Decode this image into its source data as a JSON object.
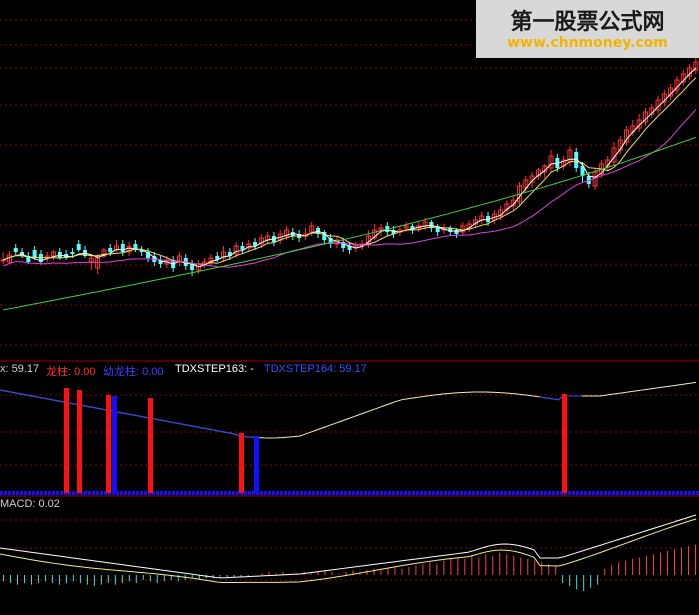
{
  "watermark": {
    "title": "第一股票公式网",
    "url": "www.chnmoney.com"
  },
  "indicator": {
    "items": [
      {
        "text": "x: 59.17",
        "color": "#d0d0d0"
      },
      {
        "text": "龙柱: 0.00",
        "color": "#ff3030"
      },
      {
        "text": "幼龙柱: 0.00",
        "color": "#4040ff"
      },
      {
        "text": "TDXSTEP163: -",
        "color": "#ffffff"
      },
      {
        "text": "TDXSTEP164: 59.17",
        "color": "#3050ff"
      }
    ]
  },
  "macd": {
    "label": "MACD: 0.02"
  },
  "colors": {
    "up": "#ff3030",
    "down": "#54ffff",
    "ma_short": "#ffffff",
    "ma_mid": "#f0e060",
    "ma_long": "#e040e0",
    "ma_longest": "#40d040",
    "grid": "#8a0a0a",
    "bar_red": "#ff1010",
    "bar_blue": "#1010ff",
    "line_blue": "#2040ff",
    "line_yellow": "#f0f0b0"
  },
  "chart_data": {
    "type": "candlestick",
    "candles": [
      [
        261,
        260,
        252,
        264
      ],
      [
        262,
        255,
        251,
        264
      ],
      [
        248,
        252,
        244,
        256
      ],
      [
        252,
        256,
        248,
        258
      ],
      [
        256,
        262,
        252,
        264
      ],
      [
        250,
        258,
        246,
        260
      ],
      [
        254,
        262,
        250,
        264
      ],
      [
        258,
        256,
        252,
        262
      ],
      [
        256,
        252,
        250,
        260
      ],
      [
        252,
        258,
        248,
        260
      ],
      [
        254,
        258,
        250,
        260
      ],
      [
        252,
        254,
        248,
        258
      ],
      [
        244,
        250,
        240,
        252
      ],
      [
        250,
        256,
        246,
        258
      ],
      [
        262,
        258,
        256,
        270
      ],
      [
        268,
        258,
        254,
        274
      ],
      [
        256,
        250,
        248,
        258
      ],
      [
        248,
        252,
        244,
        256
      ],
      [
        250,
        246,
        240,
        252
      ],
      [
        244,
        252,
        240,
        256
      ],
      [
        252,
        246,
        242,
        256
      ],
      [
        244,
        250,
        240,
        252
      ],
      [
        250,
        252,
        246,
        256
      ],
      [
        252,
        258,
        248,
        262
      ],
      [
        256,
        262,
        252,
        266
      ],
      [
        260,
        264,
        256,
        268
      ],
      [
        264,
        260,
        256,
        268
      ],
      [
        260,
        268,
        256,
        272
      ],
      [
        262,
        256,
        252,
        266
      ],
      [
        258,
        266,
        254,
        270
      ],
      [
        264,
        270,
        260,
        276
      ],
      [
        270,
        264,
        260,
        274
      ],
      [
        264,
        262,
        258,
        268
      ],
      [
        262,
        258,
        254,
        266
      ],
      [
        256,
        260,
        252,
        262
      ],
      [
        258,
        252,
        246,
        262
      ],
      [
        252,
        256,
        248,
        260
      ],
      [
        254,
        246,
        242,
        258
      ],
      [
        246,
        250,
        242,
        254
      ],
      [
        248,
        244,
        240,
        252
      ],
      [
        242,
        246,
        238,
        250
      ],
      [
        244,
        238,
        234,
        248
      ],
      [
        240,
        236,
        232,
        244
      ],
      [
        236,
        242,
        232,
        246
      ],
      [
        240,
        234,
        230,
        244
      ],
      [
        236,
        230,
        226,
        240
      ],
      [
        232,
        236,
        228,
        240
      ],
      [
        234,
        238,
        230,
        242
      ],
      [
        236,
        234,
        228,
        240
      ],
      [
        232,
        226,
        222,
        236
      ],
      [
        228,
        234,
        226,
        238
      ],
      [
        232,
        240,
        230,
        244
      ],
      [
        238,
        244,
        234,
        248
      ],
      [
        244,
        240,
        236,
        248
      ],
      [
        242,
        248,
        238,
        252
      ],
      [
        246,
        250,
        242,
        254
      ],
      [
        248,
        246,
        242,
        252
      ],
      [
        246,
        244,
        240,
        250
      ],
      [
        244,
        236,
        230,
        248
      ],
      [
        238,
        230,
        224,
        240
      ],
      [
        230,
        228,
        224,
        236
      ],
      [
        226,
        232,
        222,
        236
      ],
      [
        230,
        234,
        226,
        238
      ],
      [
        232,
        230,
        226,
        236
      ],
      [
        228,
        226,
        222,
        232
      ],
      [
        226,
        230,
        224,
        234
      ],
      [
        228,
        226,
        222,
        232
      ],
      [
        226,
        222,
        218,
        230
      ],
      [
        222,
        228,
        220,
        232
      ],
      [
        226,
        232,
        224,
        236
      ],
      [
        230,
        228,
        224,
        234
      ],
      [
        228,
        232,
        226,
        236
      ],
      [
        230,
        234,
        228,
        238
      ],
      [
        232,
        226,
        222,
        236
      ],
      [
        228,
        224,
        220,
        232
      ],
      [
        224,
        220,
        216,
        228
      ],
      [
        220,
        216,
        212,
        224
      ],
      [
        216,
        222,
        212,
        226
      ],
      [
        220,
        214,
        210,
        224
      ],
      [
        216,
        210,
        206,
        220
      ],
      [
        210,
        204,
        200,
        214
      ],
      [
        206,
        200,
        196,
        210
      ],
      [
        202,
        186,
        182,
        206
      ],
      [
        188,
        180,
        176,
        192
      ],
      [
        182,
        176,
        172,
        188
      ],
      [
        176,
        170,
        168,
        180
      ],
      [
        172,
        166,
        164,
        178
      ],
      [
        168,
        156,
        150,
        172
      ],
      [
        158,
        168,
        154,
        172
      ],
      [
        166,
        160,
        156,
        170
      ],
      [
        162,
        150,
        146,
        166
      ],
      [
        152,
        168,
        148,
        172
      ],
      [
        166,
        176,
        162,
        182
      ],
      [
        176,
        184,
        172,
        188
      ],
      [
        186,
        172,
        168,
        190
      ],
      [
        174,
        164,
        160,
        178
      ],
      [
        166,
        160,
        156,
        170
      ],
      [
        162,
        148,
        142,
        166
      ],
      [
        150,
        140,
        136,
        154
      ],
      [
        142,
        130,
        126,
        146
      ],
      [
        132,
        126,
        120,
        136
      ],
      [
        128,
        120,
        114,
        132
      ],
      [
        122,
        112,
        108,
        126
      ],
      [
        114,
        108,
        104,
        118
      ],
      [
        110,
        100,
        96,
        114
      ],
      [
        102,
        94,
        90,
        106
      ],
      [
        96,
        88,
        84,
        100
      ],
      [
        90,
        80,
        76,
        94
      ],
      [
        82,
        74,
        70,
        86
      ],
      [
        76,
        68,
        64,
        80
      ],
      [
        70,
        62,
        58,
        74
      ]
    ],
    "macd_hist": [
      -4,
      -5,
      -6,
      -5,
      -6,
      -5,
      -4,
      -5,
      -6,
      -5,
      -4,
      -5,
      -6,
      -7,
      -6,
      -5,
      -6,
      -5,
      -4,
      -5,
      -3,
      -4,
      -5,
      -4,
      -3,
      -4,
      -3,
      -2,
      -3,
      -2,
      -2,
      -1,
      -2,
      -1,
      -1,
      -1,
      0,
      1,
      2,
      1,
      2,
      1,
      1,
      2,
      1,
      2,
      3,
      2,
      1,
      2,
      3,
      2,
      3,
      4,
      3,
      4,
      5,
      4,
      5,
      6,
      7,
      8,
      7,
      9,
      10,
      11,
      10,
      12,
      11,
      13,
      12,
      14,
      13,
      12,
      11,
      10,
      9,
      8,
      7,
      6,
      -5,
      -7,
      -9,
      -10,
      -8,
      -6,
      4,
      6,
      8,
      9,
      10,
      11,
      12,
      13,
      14,
      15,
      16,
      17,
      18,
      19
    ]
  }
}
